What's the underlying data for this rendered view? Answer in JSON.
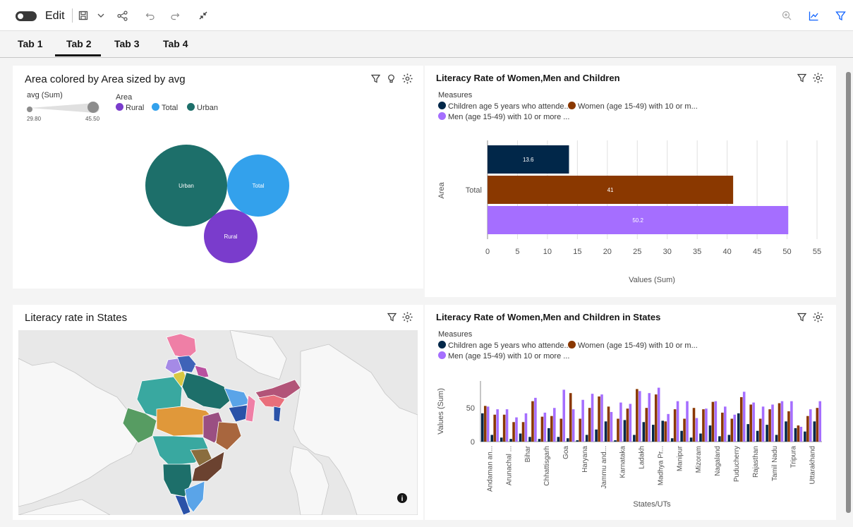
{
  "toolbar": {
    "edit_label": "Edit"
  },
  "tabs": [
    {
      "label": "Tab 1"
    },
    {
      "label": "Tab 2"
    },
    {
      "label": "Tab 3"
    },
    {
      "label": "Tab 4"
    }
  ],
  "bubble_panel": {
    "title": "Area colored by Area sized by avg",
    "size_legend_title": "avg (Sum)",
    "size_min": "29.80",
    "size_max": "45.50",
    "color_legend_title": "Area",
    "legend": [
      "Rural",
      "Total",
      "Urban"
    ],
    "bubbles": [
      {
        "label": "Urban",
        "value": 45.5
      },
      {
        "label": "Total",
        "value": 39.0
      },
      {
        "label": "Rural",
        "value": 29.8
      }
    ]
  },
  "bar_panel": {
    "title": "Literacy Rate of Women,Men and Children",
    "measures_title": "Measures",
    "legend": [
      "Children age 5 years who attende...",
      "Women (age 15-49) with 10 or m...",
      "Men (age 15-49) with 10 or more ..."
    ]
  },
  "map_panel": {
    "title": "Literacy rate in States"
  },
  "states_panel": {
    "title": "Literacy Rate of Women,Men and Children in States",
    "measures_title": "Measures",
    "legend": [
      "Children age 5 years who attende...",
      "Women (age 15-49) with 10 or m...",
      "Men (age 15-49) with 10 or more ..."
    ]
  },
  "colors": {
    "children": "#012749",
    "women": "#8a3800",
    "men": "#a56eff",
    "urban": "#1d6f6a",
    "total": "#33a1ec",
    "rural": "#7a3ccc"
  },
  "chart_data": [
    {
      "type": "bar",
      "orientation": "horizontal",
      "title": "Literacy Rate of Women,Men and Children",
      "ylabel": "Area",
      "xlabel": "Values (Sum)",
      "categories": [
        "Total"
      ],
      "series": [
        {
          "name": "Children age 5 years who attende...",
          "values": [
            13.6
          ]
        },
        {
          "name": "Women (age 15-49) with 10 or m...",
          "values": [
            41
          ]
        },
        {
          "name": "Men (age 15-49) with 10 or more ...",
          "values": [
            50.2
          ]
        }
      ],
      "xlim": [
        0,
        55
      ],
      "xticks": [
        "0",
        "5",
        "10",
        "15",
        "20",
        "25",
        "30",
        "35",
        "40",
        "45",
        "50",
        "55"
      ],
      "grid": true
    },
    {
      "type": "bar",
      "title": "Literacy Rate of Women,Men and Children in States",
      "ylabel": "Values (Sum)",
      "xlabel": "States/UTs",
      "ylim": [
        0,
        90
      ],
      "yticks": [
        "0",
        "50"
      ],
      "tick_labels": [
        "Andaman an...",
        "Arunachal ...",
        "Bihar",
        "Chhattisgarh",
        "Goa",
        "Haryana",
        "Jammu and...",
        "Karnataka",
        "Ladakh",
        "Madhya Pr...",
        "Manipur",
        "Mizoram",
        "Nagaland",
        "Puducherry",
        "Rajasthan",
        "Tamil Nadu",
        "Tripura",
        "Uttarakhand"
      ],
      "groups": 36,
      "series": [
        {
          "name": "Children age 5 years who attende...",
          "values": [
            42,
            10,
            6,
            4,
            12,
            7,
            4,
            20,
            7,
            5,
            2,
            10,
            18,
            30,
            2,
            32,
            10,
            29,
            25,
            31,
            5,
            16,
            6,
            12,
            24,
            8,
            10,
            42,
            26,
            16,
            25,
            10,
            30,
            20,
            15,
            30
          ]
        },
        {
          "name": "Women (age 15-49) with 10 or m...",
          "values": [
            53,
            40,
            40,
            29,
            29,
            60,
            37,
            38,
            34,
            72,
            34,
            50,
            67,
            52,
            34,
            49,
            78,
            50,
            70,
            30,
            48,
            34,
            50,
            48,
            59,
            43,
            34,
            66,
            55,
            34,
            48,
            57,
            45,
            24,
            38,
            50
          ]
        },
        {
          "name": "Men (age 15-49) with 10 or more ...",
          "values": [
            52,
            48,
            48,
            36,
            42,
            65,
            43,
            50,
            77,
            48,
            62,
            71,
            70,
            44,
            58,
            56,
            75,
            72,
            80,
            41,
            60,
            60,
            35,
            49,
            60,
            52,
            40,
            74,
            58,
            52,
            55,
            60,
            60,
            22,
            48,
            60
          ]
        }
      ],
      "grid": false
    }
  ]
}
